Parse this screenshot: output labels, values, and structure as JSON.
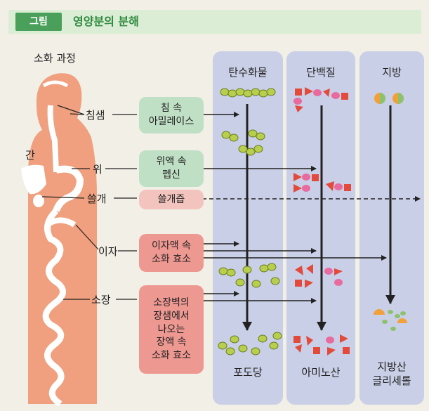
{
  "header": {
    "tag": "그림",
    "title": "영양분의 분해"
  },
  "process_label": "소화 과정",
  "organs": {
    "liver": "간",
    "salivary": "침샘",
    "stomach": "위",
    "gallbladder": "쓸개",
    "pancreas": "이자",
    "small_intestine": "소장"
  },
  "columns": {
    "carb": "탄수화물",
    "protein": "단백질",
    "fat": "지방"
  },
  "enzymes": {
    "saliva": [
      "침 속",
      "아밀레이스"
    ],
    "stomach": [
      "위액 속",
      "펩신"
    ],
    "bile": [
      "쓸개즙"
    ],
    "pancreas": [
      "이자액 속",
      "소화 효소"
    ],
    "intestine": [
      "소장벽의",
      "장샘에서",
      "나오는",
      "장액 속",
      "소화 효소"
    ]
  },
  "products": {
    "glucose": [
      "포도당"
    ],
    "amino_acid": [
      "아미노산"
    ],
    "fat_products": [
      "지방산",
      "글리세롤"
    ]
  },
  "colors": {
    "header_bg": "#dcedd5",
    "header_tag": "#4aa05a",
    "column_bg": "#c9cfe6",
    "body_silhouette": "#f0a07e",
    "glucose_bead": "#b8cf4e",
    "amino_pink": "#e86a9e",
    "amino_red": "#e34a3c",
    "fat_orange": "#f2a03a"
  }
}
